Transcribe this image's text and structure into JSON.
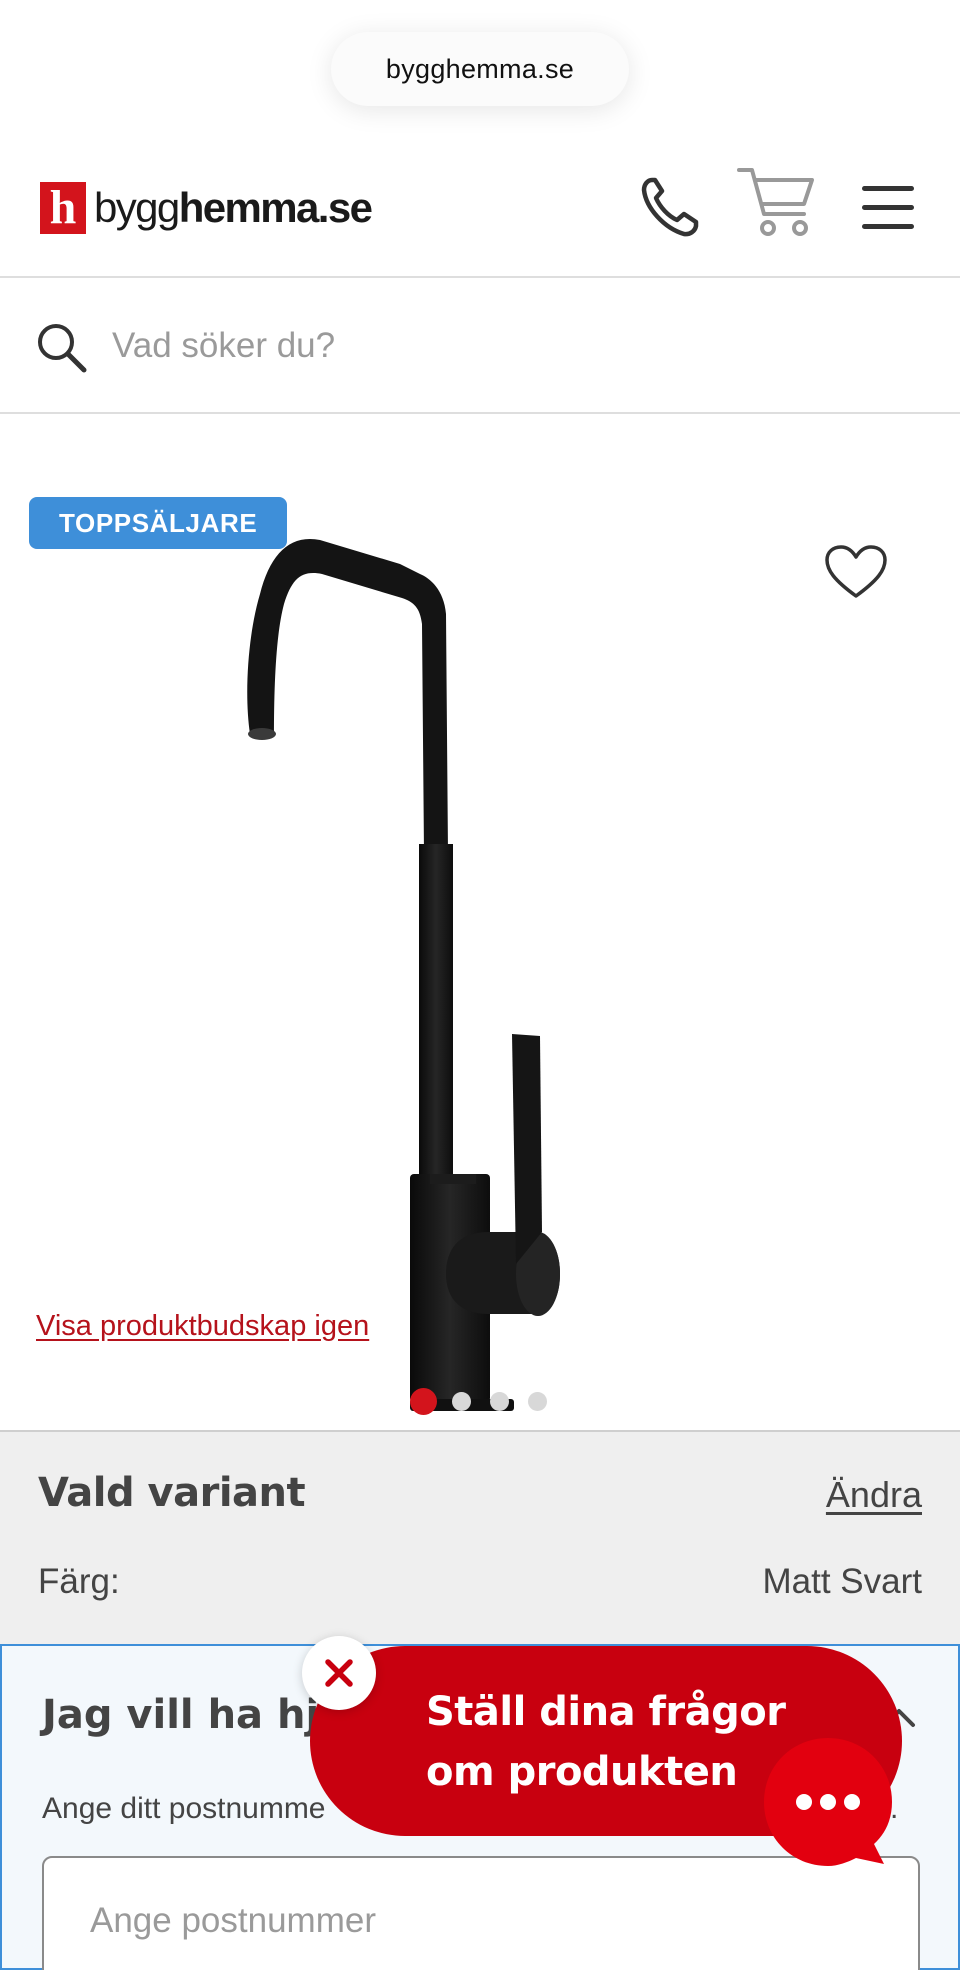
{
  "browser": {
    "url": "bygghemma.se"
  },
  "header": {
    "logo_letter": "h",
    "logo_text_light": "bygg",
    "logo_text_bold": "hemma.se"
  },
  "search": {
    "placeholder": "Vad söker du?"
  },
  "product": {
    "badge": "TOPPSÄLJARE",
    "show_message_again": "Visa produktbudskap igen",
    "image_count": 4,
    "active_image": 1
  },
  "variant": {
    "title": "Vald variant",
    "change_label": "Ändra",
    "color_label": "Färg:",
    "color_value": "Matt Svart"
  },
  "help": {
    "title_visible": "Jag vill ha hjä",
    "text_visible": "Ange ditt postnumme",
    "text_end": ".",
    "postcode_placeholder": "Ange postnummer"
  },
  "chat": {
    "line1": "Ställ dina frågor",
    "line2": "om produkten"
  },
  "colors": {
    "brand_red": "#d3141c",
    "chat_red": "#c8000f",
    "badge_blue": "#3e8fd9",
    "link_red": "#b5121b"
  }
}
